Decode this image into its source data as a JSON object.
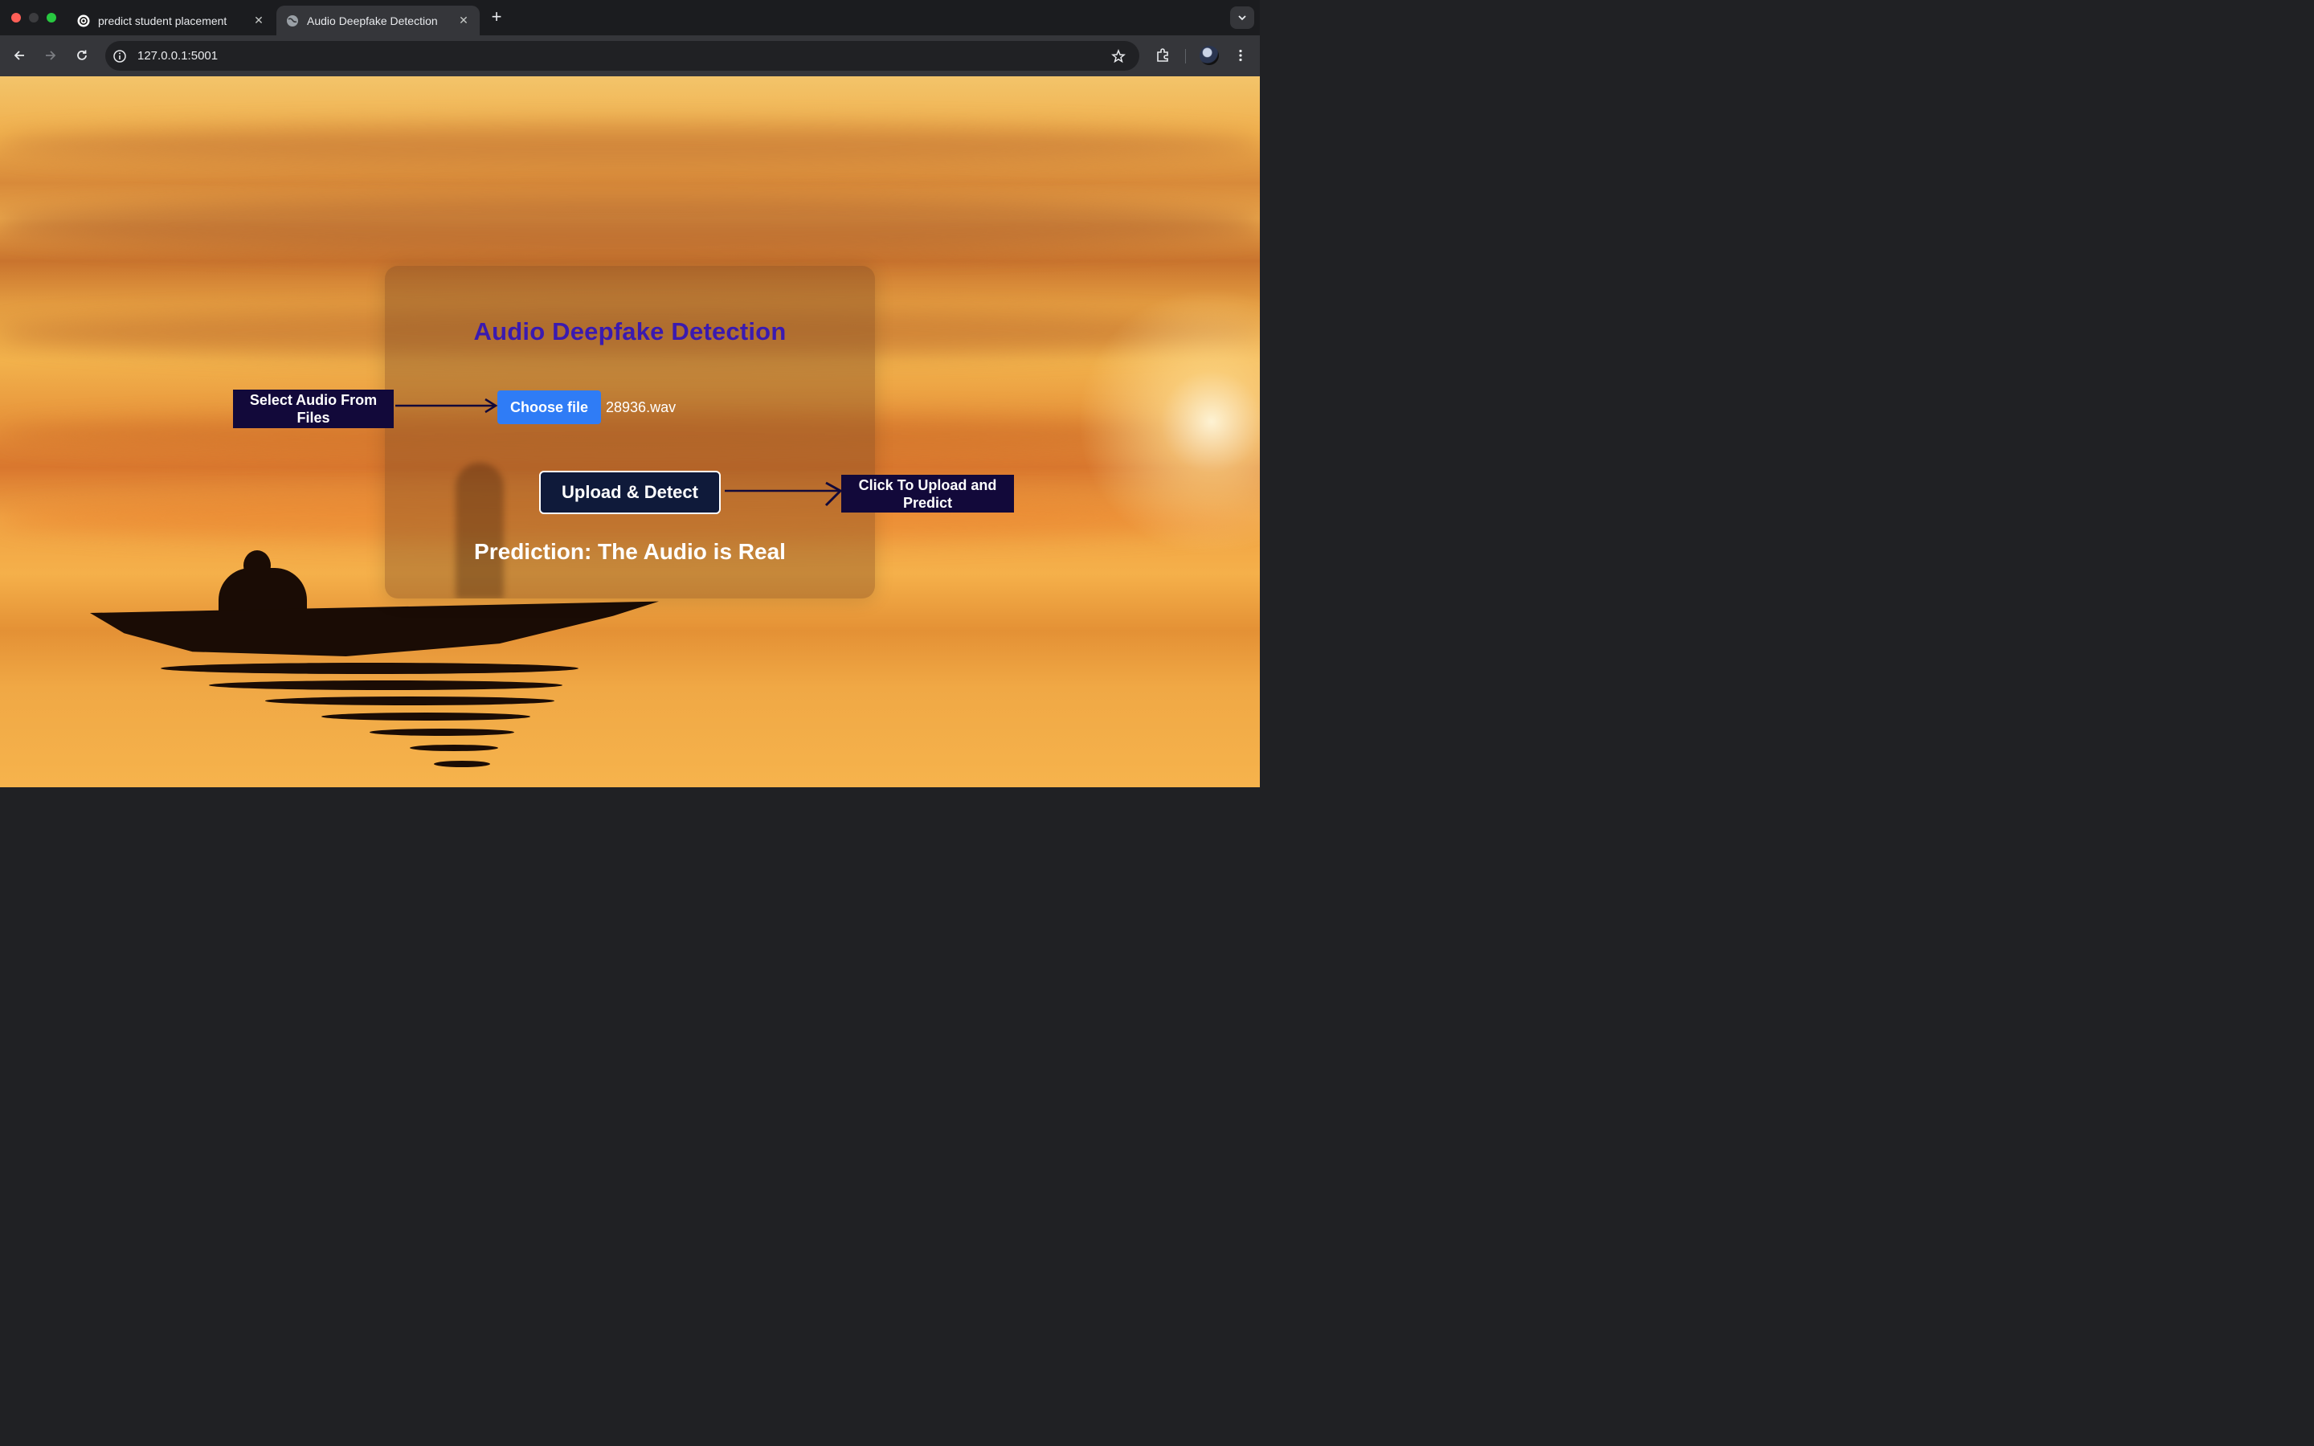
{
  "browser": {
    "tabs": [
      {
        "title": "predict student placement",
        "active": false,
        "favicon": "openai-logo-icon"
      },
      {
        "title": "Audio Deepfake Detection",
        "active": true,
        "favicon": "globe-icon"
      }
    ],
    "url": "127.0.0.1:5001"
  },
  "page": {
    "title": "Audio Deepfake Detection",
    "file_input": {
      "button_label": "Choose file",
      "selected_file": "28936.wav"
    },
    "submit_label": "Upload & Detect",
    "prediction": "Prediction: The Audio is Real",
    "annotations": {
      "select_hint": "Select Audio From Files",
      "upload_hint": "Click To Upload and Predict"
    }
  },
  "colors": {
    "title": "#3a1ab0",
    "choose_button": "#2f7cf6",
    "detect_button": "#0f1a3a",
    "callout_bg": "#12093a"
  }
}
